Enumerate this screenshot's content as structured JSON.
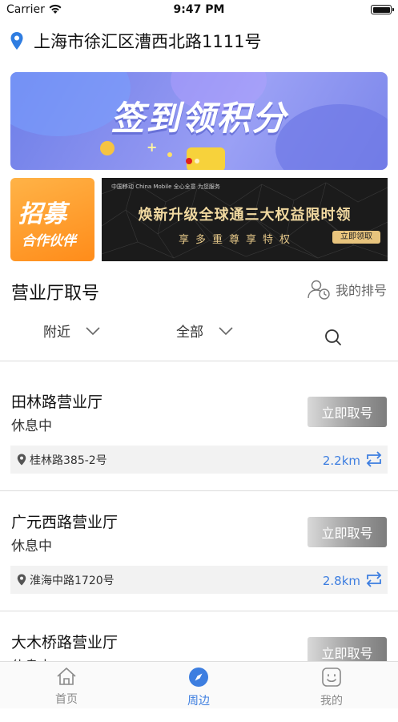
{
  "status_bar": {
    "carrier": "Carrier",
    "time": "9:47 PM"
  },
  "location": {
    "address": "上海市徐汇区漕西北路1111号",
    "pin_color": "#2f7de1"
  },
  "banner": {
    "title": "签到领积分"
  },
  "ads": {
    "left": {
      "line1": "招募",
      "line2": "合作伙伴"
    },
    "right": {
      "brand": "中国移动 China Mobile  全心全意 为您服务",
      "headline": "焕新升级全球通三大权益限时领",
      "sub": "享多重尊享特权",
      "button": "立即领取"
    }
  },
  "section": {
    "title": "营业厅取号",
    "my_queue": "我的排号"
  },
  "filters": {
    "nearby": "附近",
    "all": "全部"
  },
  "halls": [
    {
      "name": "田林路营业厅",
      "status": "休息中",
      "button": "立即取号",
      "address": "桂林路385-2号",
      "distance": "2.2km"
    },
    {
      "name": "广元西路营业厅",
      "status": "休息中",
      "button": "立即取号",
      "address": "淮海中路1720号",
      "distance": "2.8km"
    },
    {
      "name": "大木桥路营业厅",
      "status": "休息中",
      "button": "立即取号",
      "address": "",
      "distance": ""
    }
  ],
  "tabbar": {
    "items": [
      {
        "label": "首页",
        "active": false
      },
      {
        "label": "周边",
        "active": true
      },
      {
        "label": "我的",
        "active": false
      }
    ],
    "active_color": "#3d7ee0",
    "inactive_color": "#8a8a8a"
  }
}
